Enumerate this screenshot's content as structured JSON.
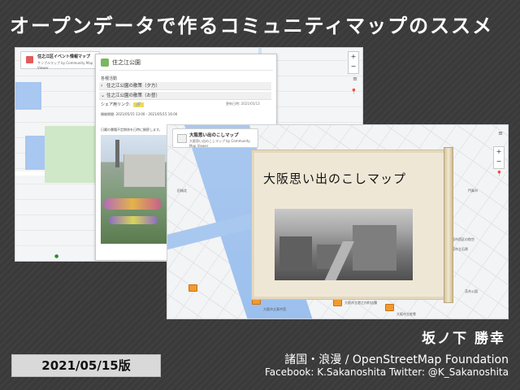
{
  "slide": {
    "title": "オープンデータで作るコミュニティマップのススメ",
    "author": "坂ノ下 勝幸",
    "affiliation": "諸国・浪漫 / OpenStreetMap Foundation",
    "contact": "Facebook: K.Sakanoshita  Twitter: @K_Sakanoshita",
    "version_badge": "2021/05/15版"
  },
  "left_screenshot": {
    "app_title": "住之江区イベント情報マップ",
    "app_subtitle": "サンプルマップ by Community Map Viewer",
    "panel": {
      "place_name": "住之江公園",
      "section_label": "各種活動",
      "rows": [
        {
          "label": "住之江公園の散策（夕方）"
        },
        {
          "label": "住之江公園の散策（お昼）"
        }
      ],
      "share_label": "シェア用リンク:",
      "share_button": "🔗",
      "updated_label": "更新日時: 2021/05/13",
      "datetime": "開催期間: 2021/05/15 13:00 - 2021/05/15 16:00",
      "note": "日曜の書籍不定期休を日時に観察します。"
    },
    "zoom_in": "+",
    "zoom_out": "−"
  },
  "right_screenshot": {
    "app_title": "大阪思い出のこしマップ",
    "app_subtitle": "大阪思い出のこしマップ by Community Map Viewer",
    "zoom_in": "+",
    "zoom_out": "−",
    "labels": [
      "旧城北",
      "門真市",
      "大阪市西区の航空",
      "大阪市立石原",
      "茨木公園",
      "大阪市立真中西",
      "大阪市立港之内町店舗",
      "大阪市立蛇骨"
    ],
    "popup_title": "大阪思い出のこしマップ"
  }
}
